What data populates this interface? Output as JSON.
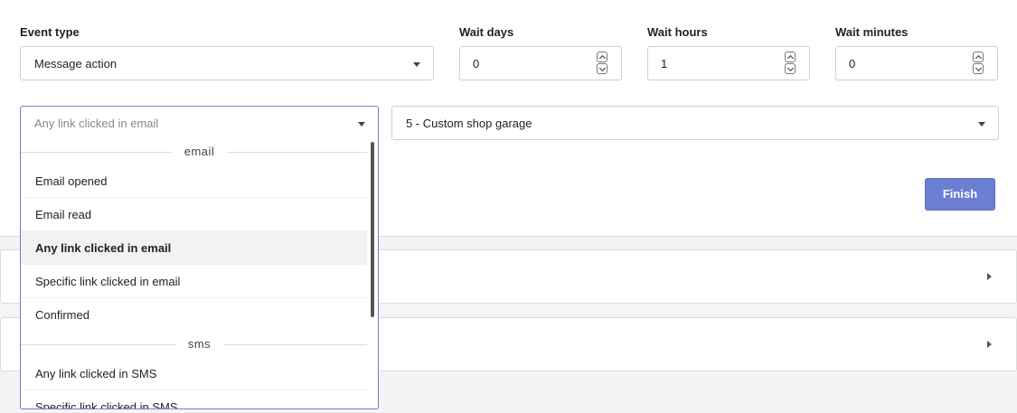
{
  "form": {
    "event_type": {
      "label": "Event type",
      "value": "Message action"
    },
    "wait_days": {
      "label": "Wait days",
      "value": "0"
    },
    "wait_hours": {
      "label": "Wait hours",
      "value": "1"
    },
    "wait_minutes": {
      "label": "Wait minutes",
      "value": "0"
    },
    "action_select": {
      "value": "Any link clicked in email"
    },
    "message_select": {
      "value": "5 - Custom shop garage"
    },
    "finish_label": "Finish"
  },
  "dropdown": {
    "groups": [
      {
        "name": "email",
        "options": [
          "Email opened",
          "Email read",
          "Any link clicked in email",
          "Specific link clicked in email",
          "Confirmed"
        ]
      },
      {
        "name": "sms",
        "options": [
          "Any link clicked in SMS",
          "Specific link clicked in SMS"
        ]
      }
    ],
    "selected": "Any link clicked in email"
  },
  "colors": {
    "accent": "#6b7fd1",
    "button": "#6b7fd1",
    "background": "#f4f4f4"
  },
  "icons": {
    "select_caret": "chevron-down-icon",
    "row_caret": "chevron-right-icon",
    "spinner": "spinner-arrows-icon"
  }
}
